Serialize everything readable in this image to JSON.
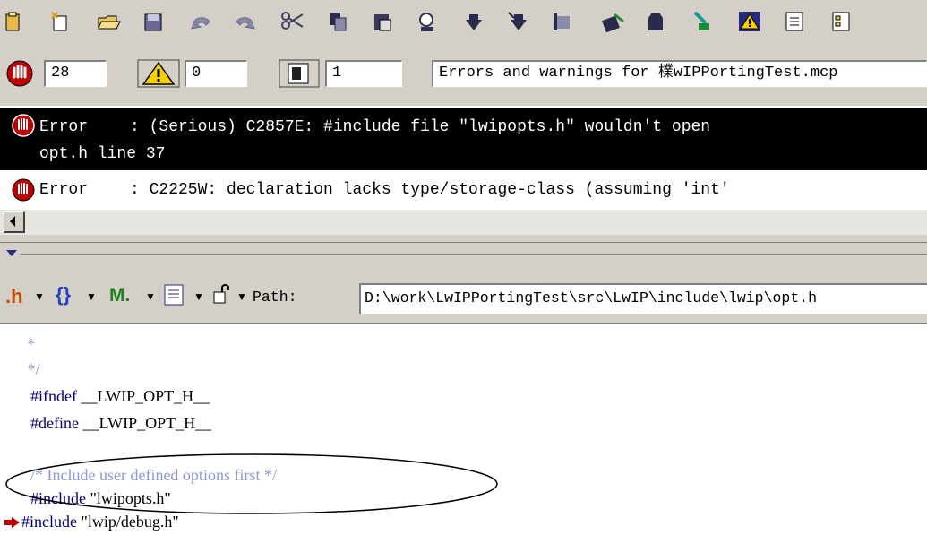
{
  "toolbar": {
    "icons": [
      "new-project-icon",
      "new-file-icon",
      "open-icon",
      "save-icon",
      "undo-icon",
      "redo-icon",
      "cut-icon",
      "copy-icon",
      "paste-icon",
      "find-icon",
      "replace-icon",
      "find-next-icon",
      "clear-icon",
      "debug-icon",
      "run-icon",
      "make-icon",
      "warning-icon",
      "list-icon",
      "list-alt-icon"
    ]
  },
  "status": {
    "errors_count": "28",
    "warnings_count": "0",
    "info_count": "1",
    "title": "Errors and warnings for 檏wIPPortingTest.mcp"
  },
  "messages": [
    {
      "type": "Error",
      "text": ": (Serious) C2857E: #include file \"lwipopts.h\" wouldn't open",
      "detail": "opt.h line 37",
      "selected": true
    },
    {
      "type": "Error",
      "text": ": C2225W: declaration lacks type/storage-class (assuming 'int'",
      "detail": "",
      "selected": false
    }
  ],
  "editor_toolbar": {
    "header_menu": ".h",
    "func_menu": "{}",
    "marker_menu": "M.",
    "doc_menu": "",
    "lock": "",
    "path_label": "Path:",
    "path_value": "D:\\work\\LwIPPortingTest\\src\\LwIP\\include\\lwip\\opt.h"
  },
  "code": {
    "lines": [
      " *",
      " */",
      "#ifndef __LWIP_OPT_H__",
      "#define __LWIP_OPT_H__",
      "",
      "/* Include user defined options first */",
      "#include \"lwipopts.h\"",
      "#include \"lwip/debug.h\""
    ],
    "line1_kw": "#ifndef",
    "line1_rest": " __LWIP_OPT_H__",
    "line2_kw": "#define",
    "line2_rest": " __LWIP_OPT_H__",
    "comment": "/* Include user defined options first */",
    "inc1_kw": "#include",
    "inc1_str": " \"lwipopts.h\"",
    "inc2_kw": "#include",
    "inc2_str": " \"lwip/debug.h\""
  }
}
